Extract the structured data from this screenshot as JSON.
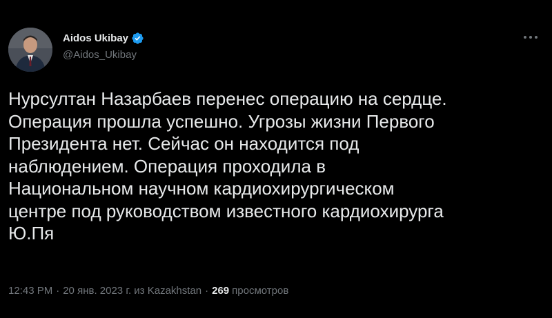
{
  "author": {
    "display_name": "Aidos Ukibay",
    "handle": "@Aidos_Ukibay",
    "verified": true
  },
  "tweet": {
    "text": "Нурсултан Назарбаев перенес операцию на сердце.\nОперация прошла успешно. Угрозы жизни Первого\nПрезидента нет. Сейчас он находится под\nнаблюдением. Операция проходила в\nНациональном научном кардиохирургическом\nцентре под руководством известного кардиохирурга\nЮ.Пя"
  },
  "meta": {
    "time": "12:43 PM",
    "separator": "·",
    "date": "20 янв. 2023 г. из Kazakhstan",
    "views_count": "269",
    "views_label": "просмотров"
  },
  "colors": {
    "background": "#000000",
    "text_primary": "#e7e9ea",
    "text_secondary": "#71767b",
    "verified_badge": "#1d9bf0"
  },
  "icons": {
    "verified": "verified-badge-icon",
    "more": "more-horizontal-icon"
  }
}
